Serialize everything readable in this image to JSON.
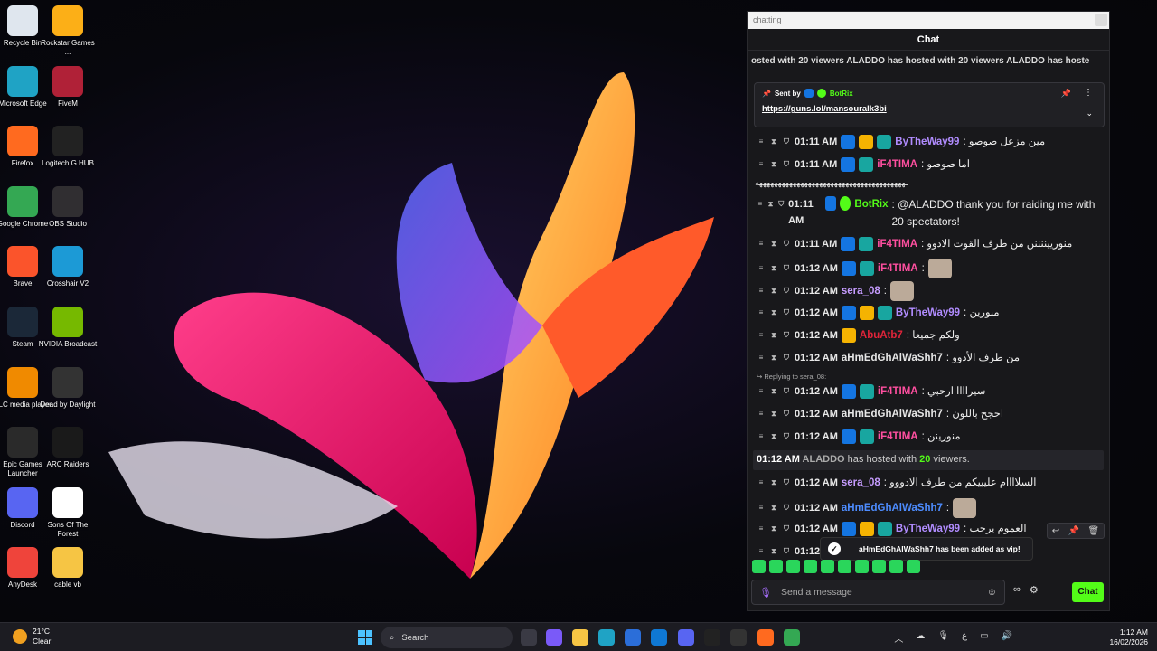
{
  "desktop": {
    "icons": [
      {
        "label": "Recycle Bin",
        "icon": "recycle-bin-icon",
        "color": "#dfe6ee"
      },
      {
        "label": "Rockstar Games ...",
        "icon": "rockstar-icon",
        "color": "#fcaf17"
      },
      {
        "label": "Microsoft Edge",
        "icon": "edge-icon",
        "color": "#1fa3c5"
      },
      {
        "label": "FiveM",
        "icon": "fivem-icon",
        "color": "#b02137"
      },
      {
        "label": "Firefox",
        "icon": "firefox-icon",
        "color": "#ff6a1f"
      },
      {
        "label": "Logitech G HUB",
        "icon": "logitech-icon",
        "color": "#222222"
      },
      {
        "label": "Google Chrome",
        "icon": "chrome-icon",
        "color": "#34a853"
      },
      {
        "label": "OBS Studio",
        "icon": "obs-icon",
        "color": "#302e31"
      },
      {
        "label": "Brave",
        "icon": "brave-icon",
        "color": "#fb542b"
      },
      {
        "label": "Crosshair V2",
        "icon": "crosshair-icon",
        "color": "#1c9ad6"
      },
      {
        "label": "Steam",
        "icon": "steam-icon",
        "color": "#1b2838"
      },
      {
        "label": "NVIDIA Broadcast",
        "icon": "nvidia-icon",
        "color": "#76b900"
      },
      {
        "label": "VLC media player",
        "icon": "vlc-icon",
        "color": "#f08a00"
      },
      {
        "label": "Dead by Daylight",
        "icon": "dbd-icon",
        "color": "#333333"
      },
      {
        "label": "Epic Games Launcher",
        "icon": "epic-icon",
        "color": "#2a2a2a"
      },
      {
        "label": "ARC Raiders",
        "icon": "arc-raiders-icon",
        "color": "#1a1a1a"
      },
      {
        "label": "Discord",
        "icon": "discord-icon",
        "color": "#5865f2"
      },
      {
        "label": "Sons Of The Forest",
        "icon": "file-icon",
        "color": "#ffffff"
      },
      {
        "label": "AnyDesk",
        "icon": "anydesk-icon",
        "color": "#ef443b"
      },
      {
        "label": "cable vb",
        "icon": "folder-icon",
        "color": "#f6c544"
      }
    ]
  },
  "chat": {
    "window_title": "chatting",
    "header": "Chat",
    "host_ticker": "osted with 20 viewers  ALADDO has hosted with 20 viewers  ALADDO has hoste",
    "pinned": {
      "sent_by_label": "Sent by",
      "sender": "BotRix",
      "link": "https://guns.lol/mansouralk3bi"
    },
    "messages": [
      {
        "time": "01:11 AM",
        "name": "ByTheWay99",
        "color": "#b18cff",
        "text": ": مين مزعل صوصو",
        "badges": [
          "mod",
          "vip",
          "sub"
        ]
      },
      {
        "time": "01:11 AM",
        "name": "iF4TIMA",
        "color": "#ff4fa0",
        "text": ": اما صوصو",
        "badges": [
          "mod",
          "sub"
        ]
      },
      {
        "time": "",
        "name": "",
        "color": "#ffffff",
        "text": "ـهههههههههههههههههههههههههههههههههههههههه",
        "badges": []
      },
      {
        "time": "01:11 AM",
        "name": "BotRix",
        "color": "#53fc18",
        "text": ": @ALADDO thank you for raiding me with 20 spectators!",
        "badges": [
          "mod",
          "ver"
        ]
      },
      {
        "time": "01:11 AM",
        "name": "iF4TIMA",
        "color": "#ff4fa0",
        "text": ": منورييننننن من طرف القوت الادوو",
        "badges": [
          "mod",
          "sub"
        ]
      },
      {
        "time": "01:12 AM",
        "name": "iF4TIMA",
        "color": "#ff4fa0",
        "text": ":",
        "badges": [
          "mod",
          "sub"
        ]
      },
      {
        "time": "01:12 AM",
        "name": "sera_08",
        "color": "#c69cff",
        "text": ":",
        "badges": []
      },
      {
        "time": "01:12 AM",
        "name": "ByTheWay99",
        "color": "#b18cff",
        "text": ": منورين",
        "badges": [
          "mod",
          "vip",
          "sub"
        ]
      },
      {
        "time": "01:12 AM",
        "name": "AbuAtb7",
        "color": "#e0243a",
        "text": ": ولكم جميعا",
        "badges": [
          "vip"
        ]
      },
      {
        "time": "01:12 AM",
        "name": "aHmEdGhAlWaShh7",
        "color": "#e6e6e6",
        "text": ": من طرف الأدوو",
        "badges": []
      },
      {
        "time": "01:12 AM",
        "name": "iF4TIMA",
        "color": "#ff4fa0",
        "text": ": سيراااا ارحبي",
        "badges": [
          "mod",
          "sub"
        ]
      },
      {
        "time": "01:12 AM",
        "name": "aHmEdGhAlWaShh7",
        "color": "#e6e6e6",
        "text": ": احجح باللون",
        "badges": []
      },
      {
        "time": "01:12 AM",
        "name": "iF4TIMA",
        "color": "#ff4fa0",
        "text": ": منورينن",
        "badges": [
          "mod",
          "sub"
        ]
      },
      {
        "time": "01:12 AM",
        "name": "sera_08",
        "color": "#c69cff",
        "text": ": السلاااام عليييكم من طرف الادووو",
        "badges": []
      },
      {
        "time": "01:12 AM",
        "name": "aHmEdGhAlWaShh7",
        "color": "#4d8cff",
        "text": ":",
        "badges": []
      },
      {
        "time": "01:12 AM",
        "name": "ByTheWay99",
        "color": "#b18cff",
        "text": ": العموم يرحب",
        "badges": [
          "mod",
          "vip",
          "sub"
        ]
      },
      {
        "time": "01:12",
        "name": "",
        "color": "#ffffff",
        "text": "",
        "badges": []
      }
    ],
    "reply_label": "Replying to sera_08:",
    "host_event": {
      "time": "01:12 AM",
      "name": "ALADDO",
      "text1": "has hosted with",
      "count": "20",
      "text2": "viewers."
    },
    "toast": "aHmEdGhAlWaShh7 has been added as vip!",
    "composer_placeholder": "Send a message",
    "chat_button": "Chat"
  },
  "taskbar": {
    "temp": "21°C",
    "condition": "Clear",
    "search_label": "Search",
    "time": "1:12 AM",
    "date": "16/02/2026",
    "lang": "ع"
  }
}
